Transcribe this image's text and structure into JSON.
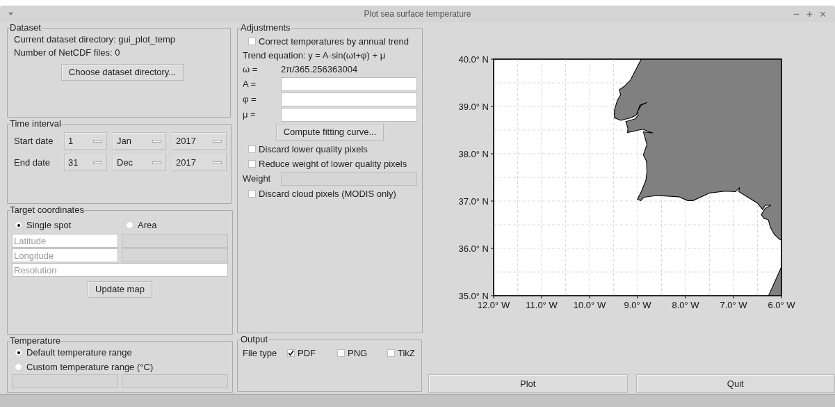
{
  "window": {
    "title": "Plot sea surface temperature"
  },
  "dataset": {
    "title": "Dataset",
    "directory_label": "Current dataset directory: gui_plot_temp",
    "files_label": "Number of NetCDF files: 0",
    "button": "Choose dataset directory..."
  },
  "time_interval": {
    "title": "Time interval",
    "rows": [
      {
        "label": "Start date",
        "day": "1",
        "month": "Jan",
        "year": "2017"
      },
      {
        "label": "End date",
        "day": "31",
        "month": "Dec",
        "year": "2017"
      }
    ]
  },
  "target": {
    "title": "Target coordinates",
    "radios": [
      {
        "label": "Single spot",
        "selected": true
      },
      {
        "label": "Area",
        "selected": false
      }
    ],
    "field_rows": [
      [
        {
          "placeholder": "Latitude",
          "disabled": false
        },
        {
          "disabled": true
        }
      ],
      [
        {
          "placeholder": "Longitude",
          "disabled": false
        },
        {
          "disabled": true
        }
      ],
      [
        {
          "placeholder": "Resolution",
          "disabled": false
        }
      ]
    ],
    "button": "Update map"
  },
  "temperature": {
    "title": "Temperature",
    "radios": [
      {
        "label": "Default temperature range",
        "selected": true
      },
      {
        "label": "Custom temperature range (°C)",
        "selected": false
      }
    ],
    "fields": [
      {
        "disabled": true
      },
      {
        "disabled": true
      }
    ]
  },
  "adjustments": {
    "title": "Adjustments",
    "items": [
      {
        "kind": "checkbox",
        "label": "Correct temperatures by annual trend",
        "checked": false
      },
      {
        "kind": "text",
        "label": "Trend equation: y = A·sin(ωt+φ) + μ"
      },
      {
        "kind": "value",
        "label": "ω =",
        "value": "2π/365.256363004"
      },
      {
        "kind": "field",
        "label": "A =",
        "disabled": false
      },
      {
        "kind": "field",
        "label": "φ =",
        "disabled": false
      },
      {
        "kind": "field",
        "label": "μ =",
        "disabled": false
      },
      {
        "kind": "button",
        "label": "Compute fitting curve..."
      },
      {
        "kind": "checkbox",
        "label": "Discard lower quality pixels",
        "checked": false
      },
      {
        "kind": "checkbox",
        "label": "Reduce weight of lower quality pixels",
        "checked": false
      },
      {
        "kind": "field",
        "label": "Weight",
        "disabled": true
      },
      {
        "kind": "checkbox",
        "label": "Discard cloud pixels (MODIS only)",
        "checked": false
      }
    ]
  },
  "output": {
    "title": "Output",
    "label": "File type",
    "options": [
      {
        "label": "PDF",
        "checked": true
      },
      {
        "label": "PNG",
        "checked": false
      },
      {
        "label": "TikZ",
        "checked": false
      }
    ]
  },
  "map": {
    "y_ticks": [
      "40.0° N",
      "39.0° N",
      "38.0° N",
      "37.0° N",
      "36.0° N",
      "35.0° N"
    ],
    "x_ticks": [
      "12.0° W",
      "11.0° W",
      "10.0° W",
      "9.0° W",
      "8.0° W",
      "7.0° W",
      "6.0° W"
    ]
  },
  "buttons": [
    {
      "label": "Plot"
    },
    {
      "label": "Quit"
    }
  ]
}
